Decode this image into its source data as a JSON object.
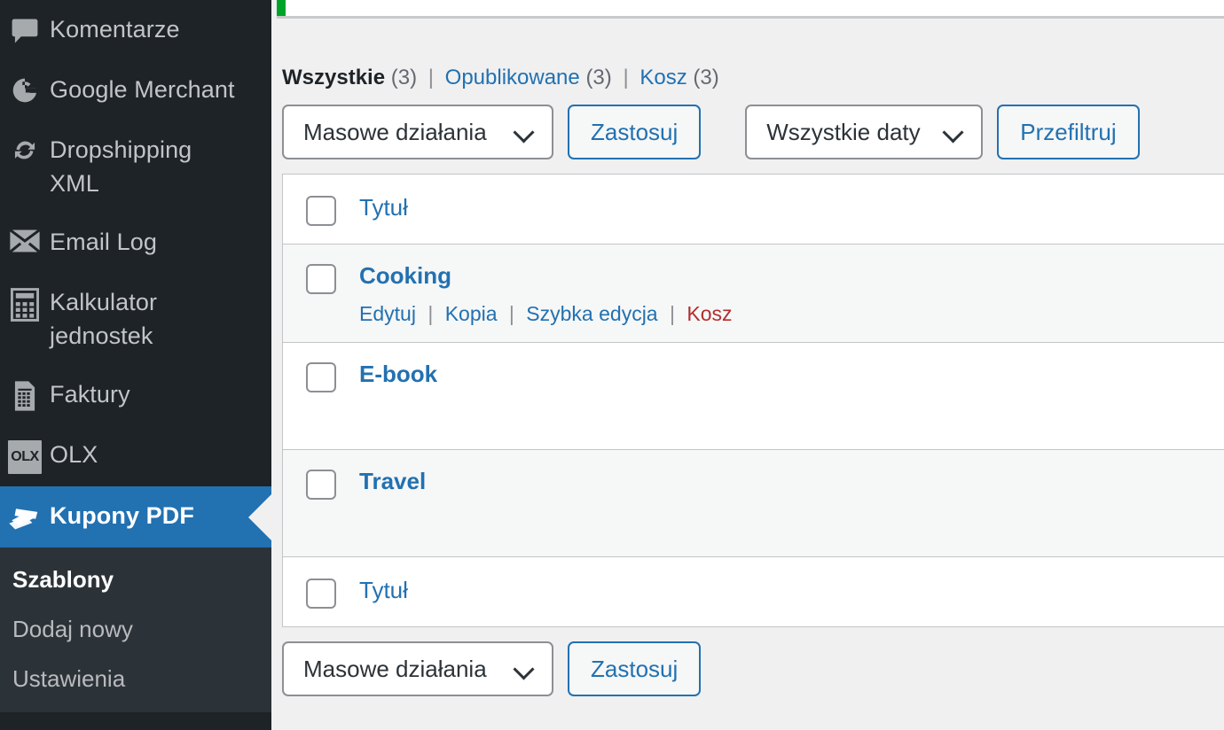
{
  "sidebar": {
    "items": [
      {
        "label": "Komentarze",
        "icon": "comment-icon",
        "active": false
      },
      {
        "label": "Google Merchant",
        "icon": "google-g-icon",
        "active": false
      },
      {
        "label": "Dropshipping XML",
        "icon": "sync-icon",
        "active": false
      },
      {
        "label": "Email Log",
        "icon": "envelope-icon",
        "active": false
      },
      {
        "label": "Kalkulator jednostek",
        "icon": "calculator-icon",
        "active": false
      },
      {
        "label": "Faktury",
        "icon": "invoice-document-icon",
        "active": false
      },
      {
        "label": "OLX",
        "icon": "olx-logo-icon",
        "active": false
      },
      {
        "label": "Kupony PDF",
        "icon": "coupon-tickets-icon",
        "active": true
      }
    ],
    "submenu": [
      {
        "label": "Szablony",
        "current": true
      },
      {
        "label": "Dodaj nowy",
        "current": false
      },
      {
        "label": "Ustawienia",
        "current": false
      }
    ]
  },
  "filters": {
    "all_label": "Wszystkie",
    "all_count": "(3)",
    "published_label": "Opublikowane",
    "published_count": "(3)",
    "trash_label": "Kosz",
    "trash_count": "(3)",
    "separator": "|"
  },
  "tablenav_top": {
    "bulk_select_value": "Masowe działania",
    "apply_label": "Zastosuj",
    "date_select_value": "Wszystkie daty",
    "filter_label": "Przefiltruj"
  },
  "tablenav_bottom": {
    "bulk_select_value": "Masowe działania",
    "apply_label": "Zastosuj"
  },
  "table": {
    "column_header": "Tytuł",
    "column_footer": "Tytuł",
    "rows": [
      {
        "title": "Cooking",
        "actions": [
          {
            "label": "Edytuj",
            "kind": "link"
          },
          {
            "label": "Kopia",
            "kind": "link"
          },
          {
            "label": "Szybka edycja",
            "kind": "link"
          },
          {
            "label": "Kosz",
            "kind": "trash"
          }
        ]
      },
      {
        "title": "E-book",
        "actions": []
      },
      {
        "title": "Travel",
        "actions": []
      }
    ]
  },
  "colors": {
    "sidebar_bg": "#1d2327",
    "submenu_bg": "#2c3338",
    "active_blue": "#2271b1",
    "link_blue": "#2271b1",
    "trash_red": "#b32d2e",
    "notice_green": "#00a32a",
    "content_bg": "#f0f0f1",
    "row_alt_bg": "#f6f7f7"
  }
}
